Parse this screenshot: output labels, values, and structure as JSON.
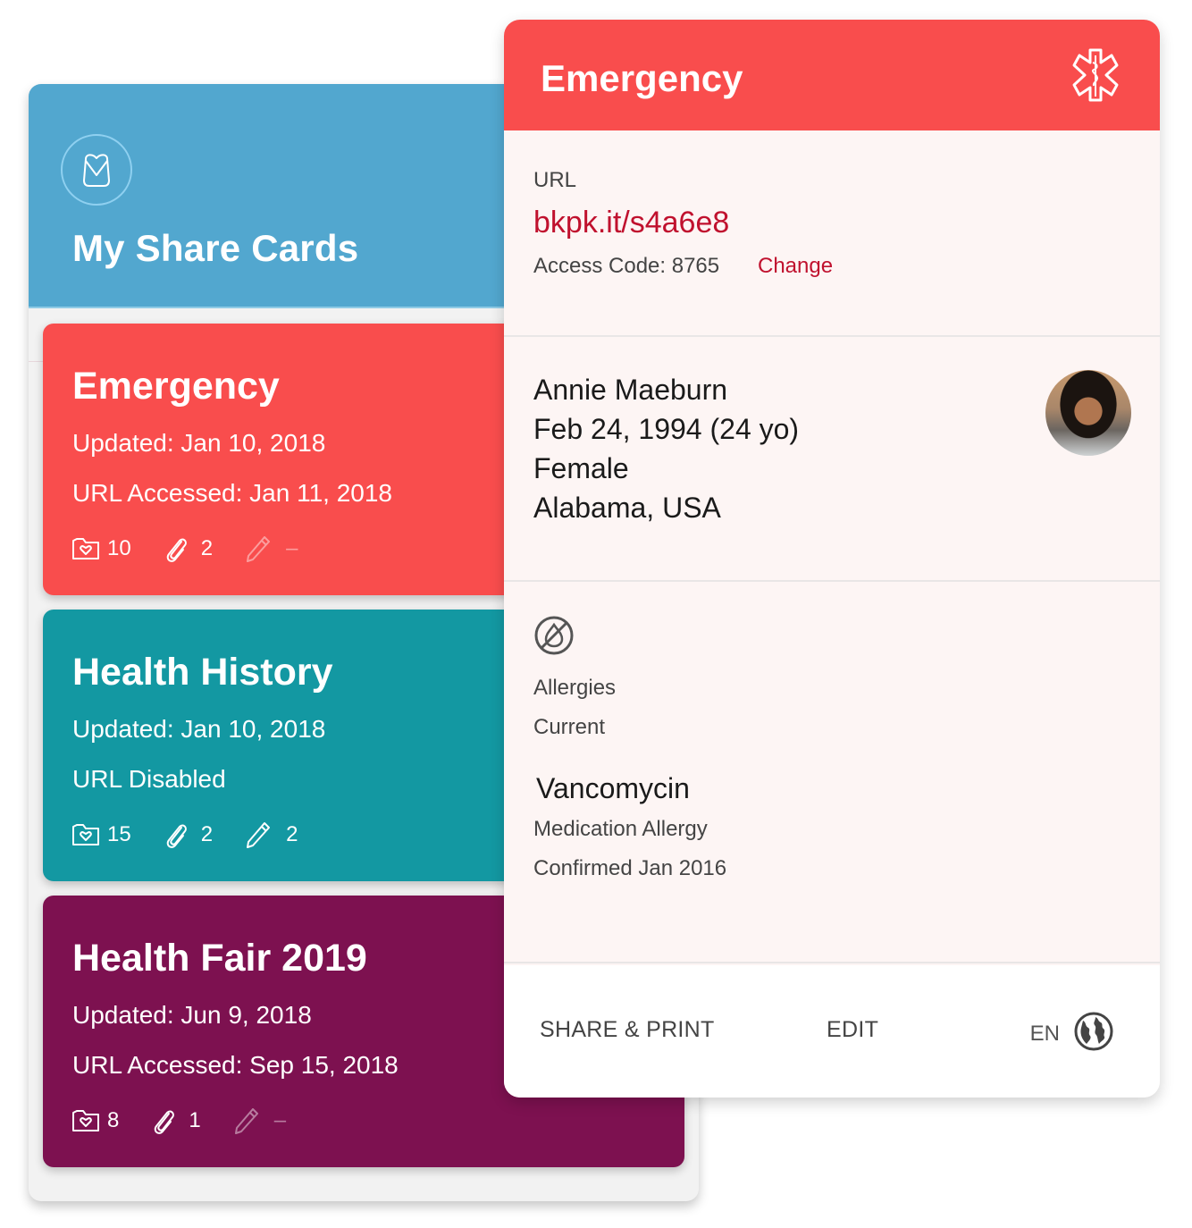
{
  "list": {
    "title": "My Share Cards",
    "header_icon": "heart-pouch-icon",
    "header_color": "#52a7cf",
    "cards": [
      {
        "title": "Emergency",
        "updated": "Updated: Jan 10, 2018",
        "url_status": "URL Accessed: Jan 11, 2018",
        "color": "#f94d4d",
        "stats": {
          "records": "10",
          "attachments": "2",
          "notes": "–"
        },
        "notes_dim": true
      },
      {
        "title": "Health History",
        "updated": "Updated: Jan 10, 2018",
        "url_status": "URL Disabled",
        "color": "#1398a2",
        "stats": {
          "records": "15",
          "attachments": "2",
          "notes": "2"
        },
        "notes_dim": false
      },
      {
        "title": "Health Fair 2019",
        "updated": "Updated: Jun 9, 2018",
        "url_status": "URL Accessed: Sep 15, 2018",
        "color": "#7d1150",
        "stats": {
          "records": "8",
          "attachments": "1",
          "notes": "–"
        },
        "notes_dim": true
      }
    ],
    "stat_icons": [
      "folder-heart-icon",
      "paperclip-icon",
      "pencil-icon"
    ]
  },
  "detail": {
    "title": "Emergency",
    "header_icon": "star-of-life-icon",
    "header_color": "#f94d4d",
    "url_label": "URL",
    "url": "bkpk.it/s4a6e8",
    "access_code": "Access Code: 8765",
    "change_label": "Change",
    "profile": {
      "name": "Annie Maeburn",
      "dob": "Feb 24, 1994 (24 yo)",
      "sex": "Female",
      "location": "Alabama, USA"
    },
    "allergy": {
      "icon": "no-allergy-drop-icon",
      "label": "Allergies",
      "status": "Current",
      "name": "Vancomycin",
      "type": "Medication Allergy",
      "confirmed": "Confirmed Jan 2016"
    },
    "footer": {
      "share_print": "SHARE & PRINT",
      "edit": "EDIT",
      "language": "EN",
      "language_icon": "globe-icon"
    },
    "accent_color": "#c0112e"
  }
}
